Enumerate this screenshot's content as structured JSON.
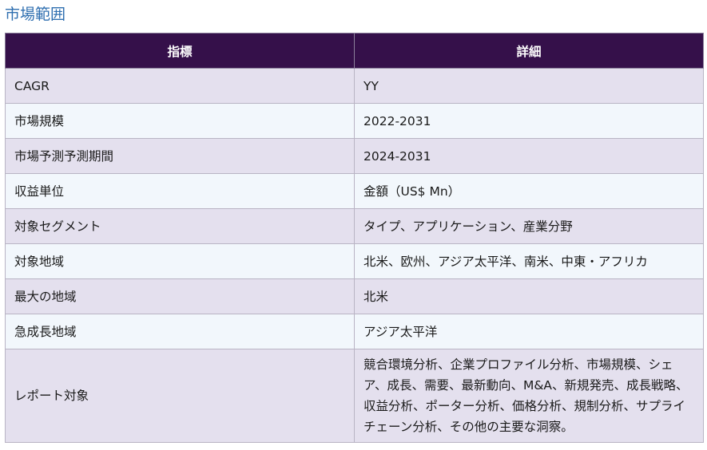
{
  "section_title": "市場範囲",
  "table": {
    "headers": [
      "指標",
      "詳細"
    ],
    "rows": [
      {
        "label": "CAGR",
        "value": "YY"
      },
      {
        "label": "市場規模",
        "value": "2022-2031"
      },
      {
        "label": "市場予測予測期間",
        "value": "2024-2031"
      },
      {
        "label": "収益単位",
        "value": "金額（US$ Mn）"
      },
      {
        "label": "対象セグメント",
        "value": "タイプ、アプリケーション、産業分野"
      },
      {
        "label": "対象地域",
        "value": "北米、欧州、アジア太平洋、南米、中東・アフリカ"
      },
      {
        "label": "最大の地域",
        "value": "北米"
      },
      {
        "label": "急成長地域",
        "value": "アジア太平洋"
      },
      {
        "label": "レポート対象",
        "value": "競合環境分析、企業プロファイル分析、市場規模、シェア、成長、需要、最新動向、M&A、新規発売、成長戦略、収益分析、ポーター分析、価格分析、規制分析、サプライチェーン分析、その他の主要な洞察。"
      }
    ]
  }
}
